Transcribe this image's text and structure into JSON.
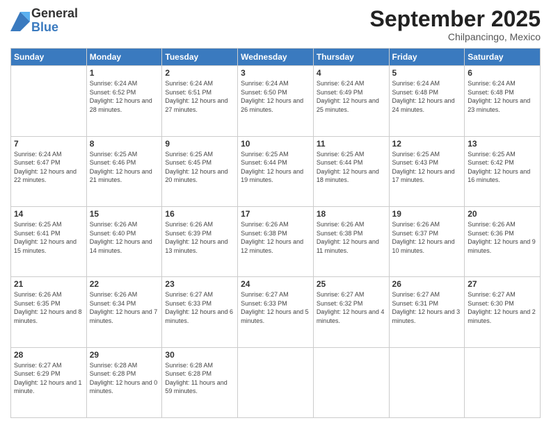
{
  "logo": {
    "general": "General",
    "blue": "Blue"
  },
  "header": {
    "month": "September 2025",
    "location": "Chilpancingo, Mexico"
  },
  "days_of_week": [
    "Sunday",
    "Monday",
    "Tuesday",
    "Wednesday",
    "Thursday",
    "Friday",
    "Saturday"
  ],
  "weeks": [
    [
      {
        "day": "",
        "sunrise": "",
        "sunset": "",
        "daylight": ""
      },
      {
        "day": "1",
        "sunrise": "Sunrise: 6:24 AM",
        "sunset": "Sunset: 6:52 PM",
        "daylight": "Daylight: 12 hours and 28 minutes."
      },
      {
        "day": "2",
        "sunrise": "Sunrise: 6:24 AM",
        "sunset": "Sunset: 6:51 PM",
        "daylight": "Daylight: 12 hours and 27 minutes."
      },
      {
        "day": "3",
        "sunrise": "Sunrise: 6:24 AM",
        "sunset": "Sunset: 6:50 PM",
        "daylight": "Daylight: 12 hours and 26 minutes."
      },
      {
        "day": "4",
        "sunrise": "Sunrise: 6:24 AM",
        "sunset": "Sunset: 6:49 PM",
        "daylight": "Daylight: 12 hours and 25 minutes."
      },
      {
        "day": "5",
        "sunrise": "Sunrise: 6:24 AM",
        "sunset": "Sunset: 6:48 PM",
        "daylight": "Daylight: 12 hours and 24 minutes."
      },
      {
        "day": "6",
        "sunrise": "Sunrise: 6:24 AM",
        "sunset": "Sunset: 6:48 PM",
        "daylight": "Daylight: 12 hours and 23 minutes."
      }
    ],
    [
      {
        "day": "7",
        "sunrise": "Sunrise: 6:24 AM",
        "sunset": "Sunset: 6:47 PM",
        "daylight": "Daylight: 12 hours and 22 minutes."
      },
      {
        "day": "8",
        "sunrise": "Sunrise: 6:25 AM",
        "sunset": "Sunset: 6:46 PM",
        "daylight": "Daylight: 12 hours and 21 minutes."
      },
      {
        "day": "9",
        "sunrise": "Sunrise: 6:25 AM",
        "sunset": "Sunset: 6:45 PM",
        "daylight": "Daylight: 12 hours and 20 minutes."
      },
      {
        "day": "10",
        "sunrise": "Sunrise: 6:25 AM",
        "sunset": "Sunset: 6:44 PM",
        "daylight": "Daylight: 12 hours and 19 minutes."
      },
      {
        "day": "11",
        "sunrise": "Sunrise: 6:25 AM",
        "sunset": "Sunset: 6:44 PM",
        "daylight": "Daylight: 12 hours and 18 minutes."
      },
      {
        "day": "12",
        "sunrise": "Sunrise: 6:25 AM",
        "sunset": "Sunset: 6:43 PM",
        "daylight": "Daylight: 12 hours and 17 minutes."
      },
      {
        "day": "13",
        "sunrise": "Sunrise: 6:25 AM",
        "sunset": "Sunset: 6:42 PM",
        "daylight": "Daylight: 12 hours and 16 minutes."
      }
    ],
    [
      {
        "day": "14",
        "sunrise": "Sunrise: 6:25 AM",
        "sunset": "Sunset: 6:41 PM",
        "daylight": "Daylight: 12 hours and 15 minutes."
      },
      {
        "day": "15",
        "sunrise": "Sunrise: 6:26 AM",
        "sunset": "Sunset: 6:40 PM",
        "daylight": "Daylight: 12 hours and 14 minutes."
      },
      {
        "day": "16",
        "sunrise": "Sunrise: 6:26 AM",
        "sunset": "Sunset: 6:39 PM",
        "daylight": "Daylight: 12 hours and 13 minutes."
      },
      {
        "day": "17",
        "sunrise": "Sunrise: 6:26 AM",
        "sunset": "Sunset: 6:38 PM",
        "daylight": "Daylight: 12 hours and 12 minutes."
      },
      {
        "day": "18",
        "sunrise": "Sunrise: 6:26 AM",
        "sunset": "Sunset: 6:38 PM",
        "daylight": "Daylight: 12 hours and 11 minutes."
      },
      {
        "day": "19",
        "sunrise": "Sunrise: 6:26 AM",
        "sunset": "Sunset: 6:37 PM",
        "daylight": "Daylight: 12 hours and 10 minutes."
      },
      {
        "day": "20",
        "sunrise": "Sunrise: 6:26 AM",
        "sunset": "Sunset: 6:36 PM",
        "daylight": "Daylight: 12 hours and 9 minutes."
      }
    ],
    [
      {
        "day": "21",
        "sunrise": "Sunrise: 6:26 AM",
        "sunset": "Sunset: 6:35 PM",
        "daylight": "Daylight: 12 hours and 8 minutes."
      },
      {
        "day": "22",
        "sunrise": "Sunrise: 6:26 AM",
        "sunset": "Sunset: 6:34 PM",
        "daylight": "Daylight: 12 hours and 7 minutes."
      },
      {
        "day": "23",
        "sunrise": "Sunrise: 6:27 AM",
        "sunset": "Sunset: 6:33 PM",
        "daylight": "Daylight: 12 hours and 6 minutes."
      },
      {
        "day": "24",
        "sunrise": "Sunrise: 6:27 AM",
        "sunset": "Sunset: 6:33 PM",
        "daylight": "Daylight: 12 hours and 5 minutes."
      },
      {
        "day": "25",
        "sunrise": "Sunrise: 6:27 AM",
        "sunset": "Sunset: 6:32 PM",
        "daylight": "Daylight: 12 hours and 4 minutes."
      },
      {
        "day": "26",
        "sunrise": "Sunrise: 6:27 AM",
        "sunset": "Sunset: 6:31 PM",
        "daylight": "Daylight: 12 hours and 3 minutes."
      },
      {
        "day": "27",
        "sunrise": "Sunrise: 6:27 AM",
        "sunset": "Sunset: 6:30 PM",
        "daylight": "Daylight: 12 hours and 2 minutes."
      }
    ],
    [
      {
        "day": "28",
        "sunrise": "Sunrise: 6:27 AM",
        "sunset": "Sunset: 6:29 PM",
        "daylight": "Daylight: 12 hours and 1 minute."
      },
      {
        "day": "29",
        "sunrise": "Sunrise: 6:28 AM",
        "sunset": "Sunset: 6:28 PM",
        "daylight": "Daylight: 12 hours and 0 minutes."
      },
      {
        "day": "30",
        "sunrise": "Sunrise: 6:28 AM",
        "sunset": "Sunset: 6:28 PM",
        "daylight": "Daylight: 11 hours and 59 minutes."
      },
      {
        "day": "",
        "sunrise": "",
        "sunset": "",
        "daylight": ""
      },
      {
        "day": "",
        "sunrise": "",
        "sunset": "",
        "daylight": ""
      },
      {
        "day": "",
        "sunrise": "",
        "sunset": "",
        "daylight": ""
      },
      {
        "day": "",
        "sunrise": "",
        "sunset": "",
        "daylight": ""
      }
    ]
  ]
}
